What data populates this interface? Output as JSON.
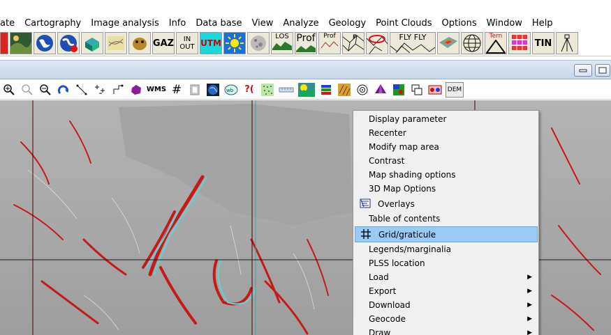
{
  "menubar": {
    "items": [
      "ate",
      "Cartography",
      "Image analysis",
      "Info",
      "Data base",
      "View",
      "Analyze",
      "Geology",
      "Point Clouds",
      "Options",
      "Window",
      "Help"
    ]
  },
  "toolbar_big": {
    "gaz": "GAZ",
    "inout_top": "IN",
    "inout_bottom": "OUT",
    "utm": "UTM",
    "los": "LOS",
    "prof": "Prof",
    "prof_small": "Prof",
    "fly1": "FLY",
    "fly2": "FLY",
    "tern": "Tern",
    "tin": "TIN"
  },
  "toolbar_small": {
    "wms": "WMS",
    "dem": "DEM",
    "grid_glyph": "#",
    "query_glyph": "?("
  },
  "context_menu": {
    "items": [
      {
        "label": "Display parameter",
        "icon": "",
        "submenu": false,
        "highlighted": false
      },
      {
        "label": "Recenter",
        "icon": "",
        "submenu": false,
        "highlighted": false
      },
      {
        "label": "Modify map area",
        "icon": "",
        "submenu": false,
        "highlighted": false
      },
      {
        "label": "Contrast",
        "icon": "",
        "submenu": false,
        "highlighted": false
      },
      {
        "label": "Map shading options",
        "icon": "",
        "submenu": false,
        "highlighted": false
      },
      {
        "label": "3D Map Options",
        "icon": "",
        "submenu": false,
        "highlighted": false
      },
      {
        "label": "Overlays",
        "icon": "overlays-icon",
        "submenu": false,
        "highlighted": false
      },
      {
        "label": "Table of contents",
        "icon": "",
        "submenu": false,
        "highlighted": false
      },
      {
        "label": "Grid/graticule",
        "icon": "grid-icon",
        "submenu": false,
        "highlighted": true
      },
      {
        "label": "Legends/marginalia",
        "icon": "",
        "submenu": false,
        "highlighted": false
      },
      {
        "label": "PLSS location",
        "icon": "",
        "submenu": false,
        "highlighted": false
      },
      {
        "label": "Load",
        "icon": "",
        "submenu": true,
        "highlighted": false
      },
      {
        "label": "Export",
        "icon": "",
        "submenu": true,
        "highlighted": false
      },
      {
        "label": "Download",
        "icon": "",
        "submenu": true,
        "highlighted": false
      },
      {
        "label": "Geocode",
        "icon": "",
        "submenu": true,
        "highlighted": false
      },
      {
        "label": "Draw",
        "icon": "",
        "submenu": true,
        "highlighted": false
      }
    ]
  },
  "colors": {
    "highlight": "#99c9f5",
    "menu_bg": "#f0f0f0",
    "map_bg": "#a9a9a9",
    "grid_line_red": "#4a0000",
    "grid_line_black": "#1a1a1a"
  }
}
